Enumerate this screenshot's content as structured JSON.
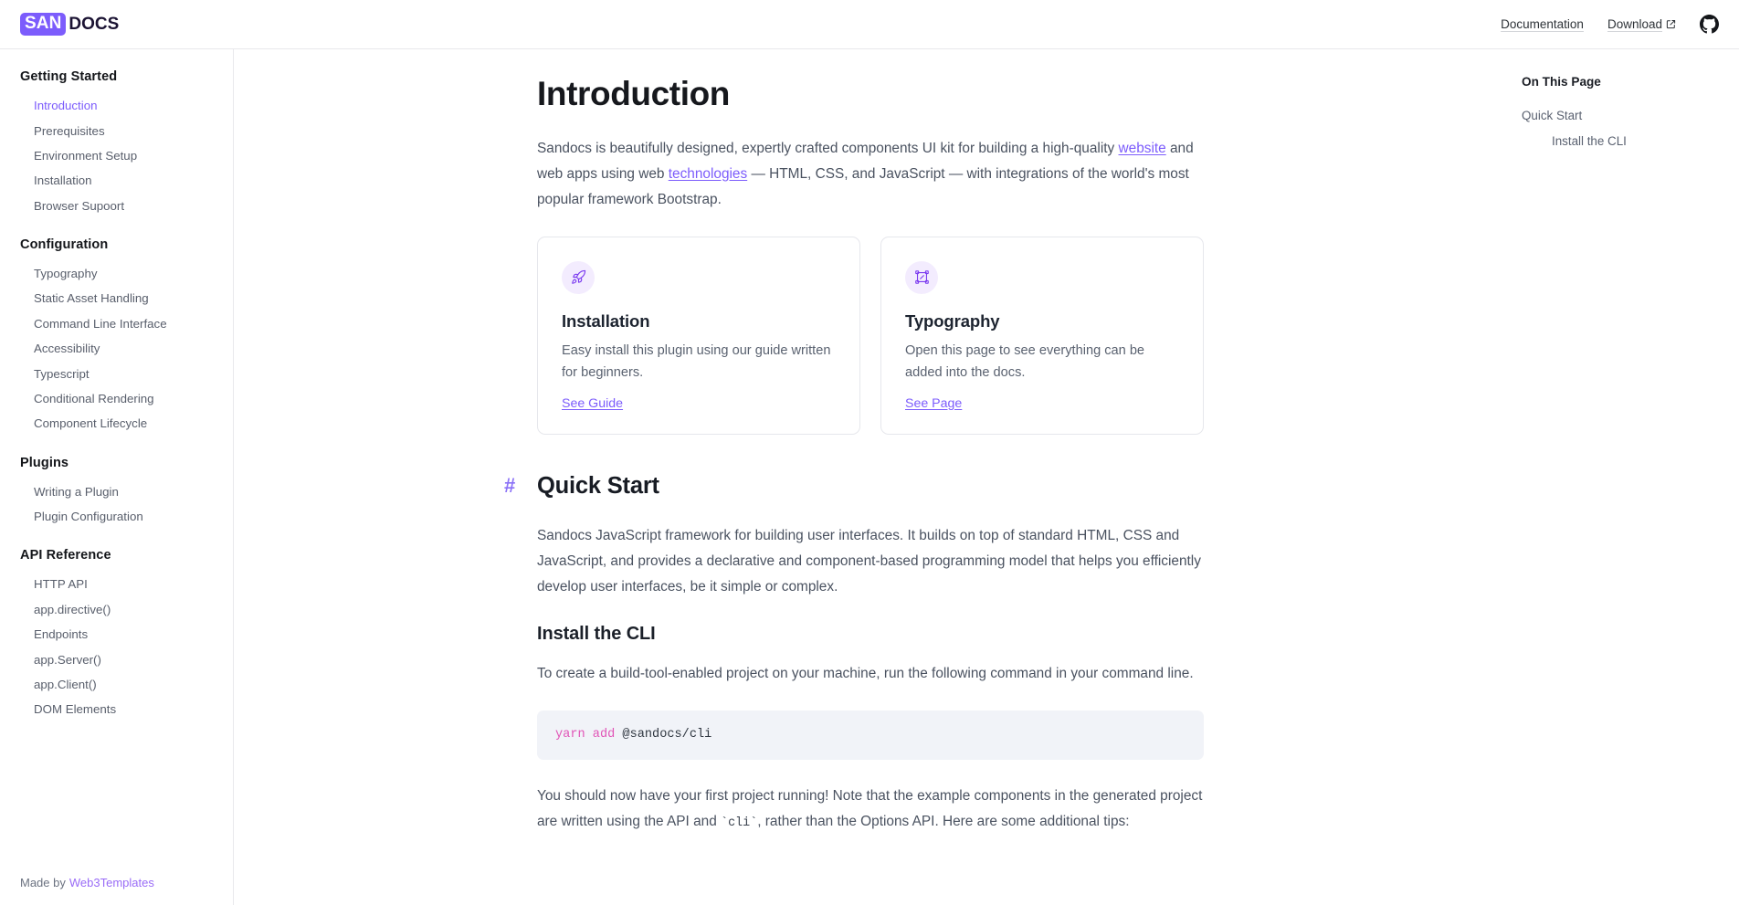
{
  "header": {
    "logo_badge": "SAN",
    "logo_word": "DOCS",
    "nav": [
      {
        "label": "Documentation",
        "external": false
      },
      {
        "label": "Download",
        "external": true
      }
    ],
    "github_icon": "github-icon"
  },
  "sidebar": {
    "groups": [
      {
        "title": "Getting Started",
        "items": [
          {
            "label": "Introduction",
            "active": true
          },
          {
            "label": "Prerequisites",
            "active": false
          },
          {
            "label": "Environment Setup",
            "active": false
          },
          {
            "label": "Installation",
            "active": false
          },
          {
            "label": "Browser Supoort",
            "active": false
          }
        ]
      },
      {
        "title": "Configuration",
        "items": [
          {
            "label": "Typography",
            "active": false
          },
          {
            "label": "Static Asset Handling",
            "active": false
          },
          {
            "label": "Command Line Interface",
            "active": false
          },
          {
            "label": "Accessibility",
            "active": false
          },
          {
            "label": "Typescript",
            "active": false
          },
          {
            "label": "Conditional Rendering",
            "active": false
          },
          {
            "label": "Component Lifecycle",
            "active": false
          }
        ]
      },
      {
        "title": "Plugins",
        "items": [
          {
            "label": "Writing a Plugin",
            "active": false
          },
          {
            "label": "Plugin Configuration",
            "active": false
          }
        ]
      },
      {
        "title": "API Reference",
        "items": [
          {
            "label": "HTTP API",
            "active": false
          },
          {
            "label": "app.directive()",
            "active": false
          },
          {
            "label": "Endpoints",
            "active": false
          },
          {
            "label": "app.Server()",
            "active": false
          },
          {
            "label": "app.Client()",
            "active": false
          },
          {
            "label": "DOM Elements",
            "active": false
          }
        ]
      }
    ],
    "footer_prefix": "Made by",
    "footer_link": "Web3Templates"
  },
  "main": {
    "page_title": "Introduction",
    "intro": {
      "part1": "Sandocs is beautifully designed, expertly crafted components UI kit for building a high-quality ",
      "link1": "website",
      "part2": " and web apps using web ",
      "link2": "technologies",
      "part3": " — HTML, CSS, and JavaScript — with integrations of the world's most popular framework Bootstrap."
    },
    "cards": [
      {
        "icon": "rocket-icon",
        "title": "Installation",
        "desc": "Easy install this plugin using our guide written for beginners.",
        "link": "See Guide"
      },
      {
        "icon": "selection-frame-icon",
        "title": "Typography",
        "desc": "Open this page to see everything can be added into the docs.",
        "link": "See Page"
      }
    ],
    "quick_start": {
      "anchor": "#",
      "title": "Quick Start",
      "paragraph": "Sandocs JavaScript framework for building user interfaces. It builds on top of standard HTML, CSS and JavaScript, and provides a declarative and component-based programming model that helps you efficiently develop user interfaces, be it simple or complex."
    },
    "install_cli": {
      "title": "Install the CLI",
      "paragraph": "To create a build-tool-enabled project on your machine, run the following command in your command line.",
      "code_keyword": "yarn add",
      "code_rest": " @sandocs/cli",
      "after_part1": "You should now have your first project running! Note that the example components in the generated project are written using the API and ",
      "after_code": "`cli`",
      "after_part2": ", rather than the Options API. Here are some additional tips:"
    }
  },
  "toc": {
    "title": "On This Page",
    "items": [
      {
        "label": "Quick Start",
        "sub": false
      },
      {
        "label": "Install the CLI",
        "sub": true
      }
    ]
  },
  "colors": {
    "accent": "#7c5cfc",
    "accent_light": "#f3ecfe",
    "text_body": "#4a5260",
    "text_heading": "#16181d",
    "code_bg": "#f1f3f8",
    "code_keyword": "#e155b7",
    "border": "#e8e8ec"
  }
}
